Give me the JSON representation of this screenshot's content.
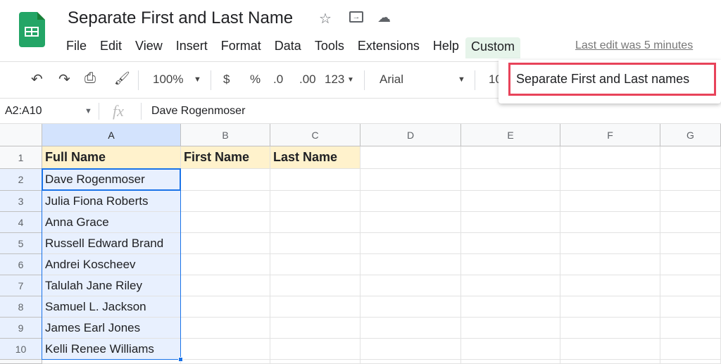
{
  "app": {
    "title": "Separate First and Last Name",
    "last_edit": "Last edit was 5 minutes"
  },
  "menu": [
    "File",
    "Edit",
    "View",
    "Insert",
    "Format",
    "Data",
    "Tools",
    "Extensions",
    "Help",
    "Custom"
  ],
  "custom_menu": {
    "items": [
      "Separate First and Last names"
    ],
    "highlight_color": "#e8435a"
  },
  "toolbar": {
    "zoom": "100%",
    "currency": "$",
    "percent": "%",
    "dec_decrease": ".0",
    "dec_increase": ".00",
    "format": "123",
    "font": "Arial",
    "font_size": "10"
  },
  "formula_bar": {
    "name_box": "A2:A10",
    "fx": "fx",
    "value": "Dave Rogenmoser"
  },
  "columns": [
    "A",
    "B",
    "C",
    "D",
    "E",
    "F",
    "G"
  ],
  "rows": [
    "1",
    "2",
    "3",
    "4",
    "5",
    "6",
    "7",
    "8",
    "9",
    "10"
  ],
  "headers": [
    "Full Name",
    "First Name",
    "Last Name"
  ],
  "full_names": [
    "Dave Rogenmoser",
    "Julia Fiona Roberts",
    "Anna Grace",
    "Russell Edward Brand",
    "Andrei Koscheev",
    "Talulah Jane Riley",
    "Samuel L. Jackson",
    "James Earl Jones",
    "Kelli Renee Williams"
  ],
  "colors": {
    "selection": "#1a73e8",
    "header_fill": "#fff2cc",
    "logo": "#23a566"
  }
}
